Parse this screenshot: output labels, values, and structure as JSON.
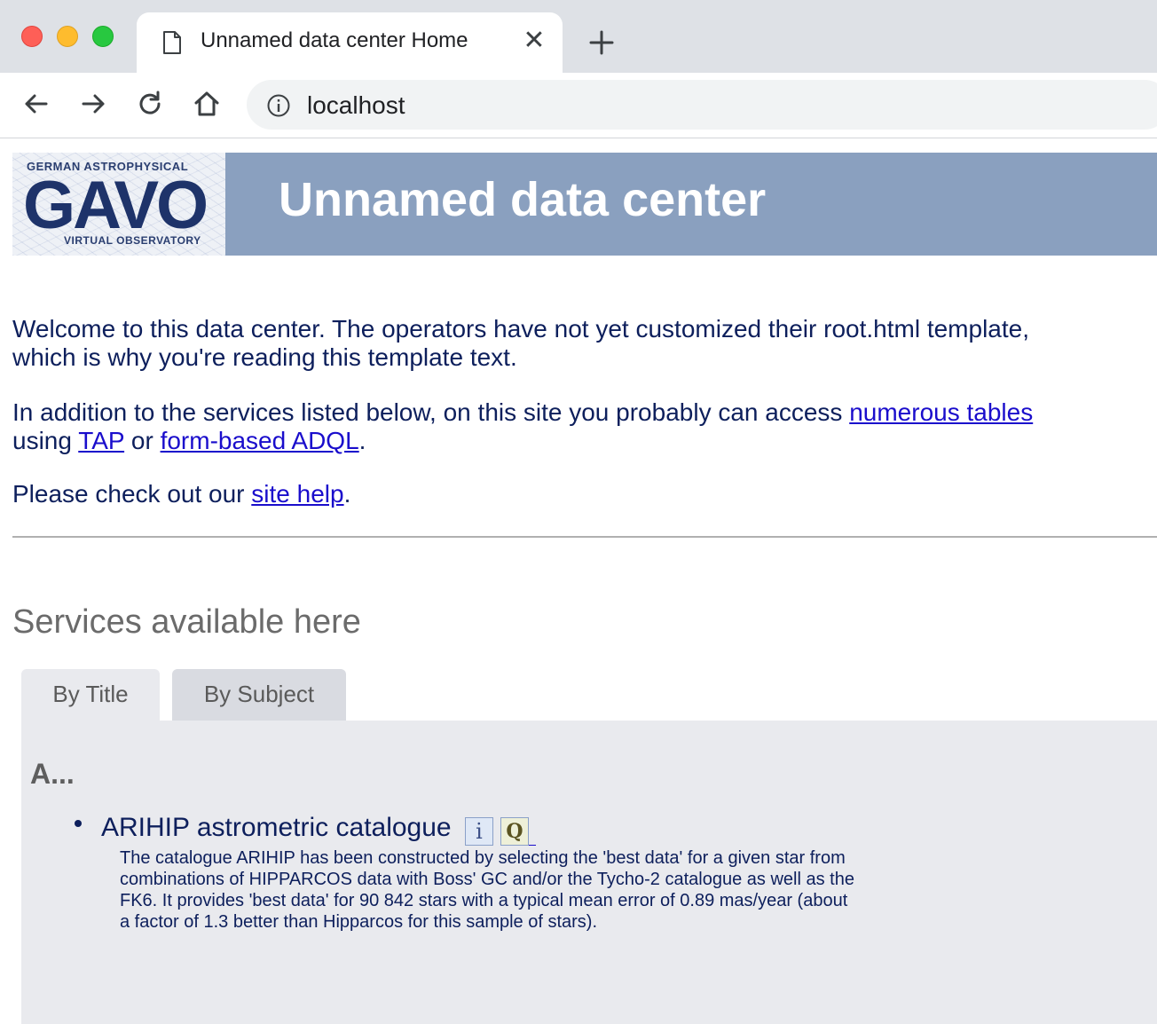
{
  "browser": {
    "tab_title": "Unnamed data center Home",
    "tab_close_glyph": "✕",
    "url": "localhost"
  },
  "logo": {
    "top_line": "GERMAN ASTROPHYSICAL",
    "main": "GAVO",
    "bottom_line": "VIRTUAL OBSERVATORY"
  },
  "header": {
    "site_title": "Unnamed data center"
  },
  "intro": {
    "p1": "Welcome to this data center. The operators have not yet customized their root.html template, which is why you're reading this template text.",
    "p2_before": "In addition to the services listed below, on this site you probably can access ",
    "p2_link_tables": "numerous tables",
    "p2_using": " using ",
    "p2_link_tap": "TAP",
    "p2_or": " or ",
    "p2_link_adql": "form-based ADQL",
    "p2_end": ".",
    "p3_before": "Please check out our ",
    "p3_link_help": "site help",
    "p3_end": "."
  },
  "services": {
    "heading": "Services available here",
    "tabs": [
      {
        "label": "By Title",
        "active": true
      },
      {
        "label": "By Subject",
        "active": false
      }
    ],
    "groups": [
      {
        "letter": "A...",
        "items": [
          {
            "title": "ARIHIP astrometric catalogue",
            "info_glyph": "i",
            "query_glyph": "Q",
            "description": "The catalogue ARIHIP has been constructed by selecting the 'best data' for a given star from combinations of HIPPARCOS data with Boss' GC and/or the Tycho-2 catalogue as well as the FK6. It provides 'best data' for 90 842 stars with a typical mean error of 0.89 mas/year (about a factor of 1.3 better than Hipparcos for this sample of stars)."
          }
        ]
      }
    ]
  },
  "colors": {
    "header_band": "#8aa0bf",
    "text": "#0d1f5c",
    "link": "#1a0dcc",
    "panel": "#e9eaee"
  }
}
